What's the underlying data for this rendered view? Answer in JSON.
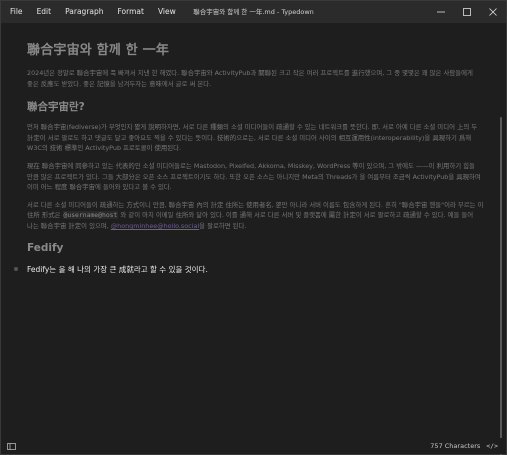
{
  "window": {
    "title": "聯合宇宙와 함께 한 一年.md - Typedown"
  },
  "menu": {
    "items": [
      "File",
      "Edit",
      "Paragraph",
      "Format",
      "View"
    ]
  },
  "document": {
    "title": "聯合宇宙와 함께 한 一年",
    "intro": "2024년은 정말로 聯合宇宙에 푹 빠져서 지낸 한 해였다. 聯合宇宙와 ActivityPub과 關聯된 크고 작은 여러 프로젝트를 進行했으며, 그 중 몇몇은 꽤 많은 사람들에게 좋은 反應도 받았다. 좋은 記憶을 남겨두자는 意味에서 글로 써 본다.",
    "h2_what": "聯合宇宙란?",
    "para1": "먼저 聯合宇宙(fediverse)가 무엇인지 짧게 說明하자면, 서로 다른 種類의 소셜 미디어들이 疏通할 수 있는 네트워크를 뜻한다. 即, 서로 아예 다른 소셜 미디어 上의 두 計定이 서로 팔로도 하고 댓글도 달고 좋아요도 찍을 수 있다는 뜻이다. 技術的으로는, 서로 다른 소셜 미디어 사이의 相互運用性(interoperability)을 具現하기 爲해 W3C의 技術 標準인 ActivityPub 프로토콜이 使用된다.",
    "para2": "現在 聯合宇宙에 同參하고 있는 代表的인 소셜 미디어들로는 Mastodon, Pixelfed, Akkoma, Misskey, WordPress 等이 있으며, 그 밖에도 ——이 利用하기 힘들 만큼 많은 프로젝트가 있다. 그들 大部分은 오픈 소스 프로젝트이기도 하다. 또한 오픈 소스는 아니지만 Meta의 Threads가 을 여름부터 조금씩 ActivityPub을 具現하여 이미 어느 程度 聯合宇宙에 들어와 있다고 볼 수 있다.",
    "para3_before": "서로 다른 소셜 미디어들이 疏通하는 方式이니 만큼, 聯合宇宙 內의 計定 住所는 使用者名, 뿐만 아니라 서버 이름도 包含하게 된다. 흔히 \"聯合宇宙 핸들\"이라 부르는 이 住所 形式은 ",
    "para3_code": "@username@host",
    "para3_middle": " 와 같이 마치 이메일 住所와 닮아 있다. 이를 通해 서로 다른 서버 및 플랫폼에 屬한 計定이 서로 팔로하고 疏通할 수 있다. 예들 들어 나는 聯合宇宙 計定이 있으며, ",
    "para3_link": "@hongminhee@hollo.social",
    "para3_after": "을 팔로하면 된다.",
    "h2_fedify": "Fedify",
    "focus_line": "Fedify는 올 해 나의 가장 큰 成就라고 할 수 있을 것이다."
  },
  "status": {
    "char_count": "757 Characters",
    "code_toggle": "</>"
  },
  "icons": {
    "sidebar": "sidebar-toggle-icon",
    "minimize": "minimize-icon",
    "maximize": "maximize-icon",
    "close": "close-icon"
  },
  "colors": {
    "background": "#1e1e1e",
    "titlebar": "#2b2b2b",
    "link": "#6f5f96"
  }
}
